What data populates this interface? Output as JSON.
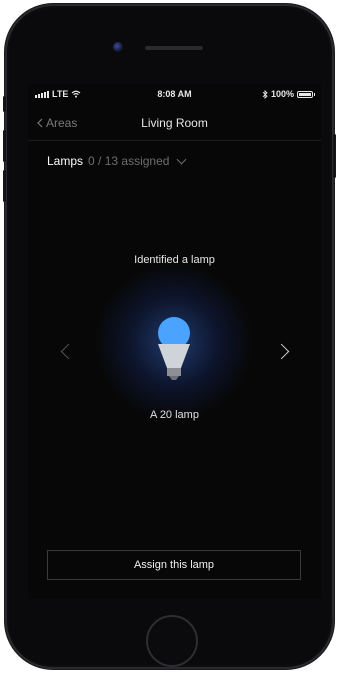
{
  "statusbar": {
    "carrier": "LTE",
    "time": "8:08 AM",
    "battery_text": "100%",
    "battery_level": 1.0
  },
  "navbar": {
    "back_label": "Areas",
    "title": "Living Room"
  },
  "lamps": {
    "title": "Lamps",
    "count_text": "0 / 13 assigned"
  },
  "main": {
    "identified_text": "Identified a lamp",
    "lamp_name": "A 20 lamp",
    "bulb_color": "#4aa3ff"
  },
  "assign_button_label": "Assign this lamp",
  "icons": [
    "wifi-icon",
    "bluetooth-icon",
    "battery-icon",
    "chevron-left-icon",
    "chevron-down-icon",
    "lightbulb-icon",
    "chevron-right-icon"
  ]
}
